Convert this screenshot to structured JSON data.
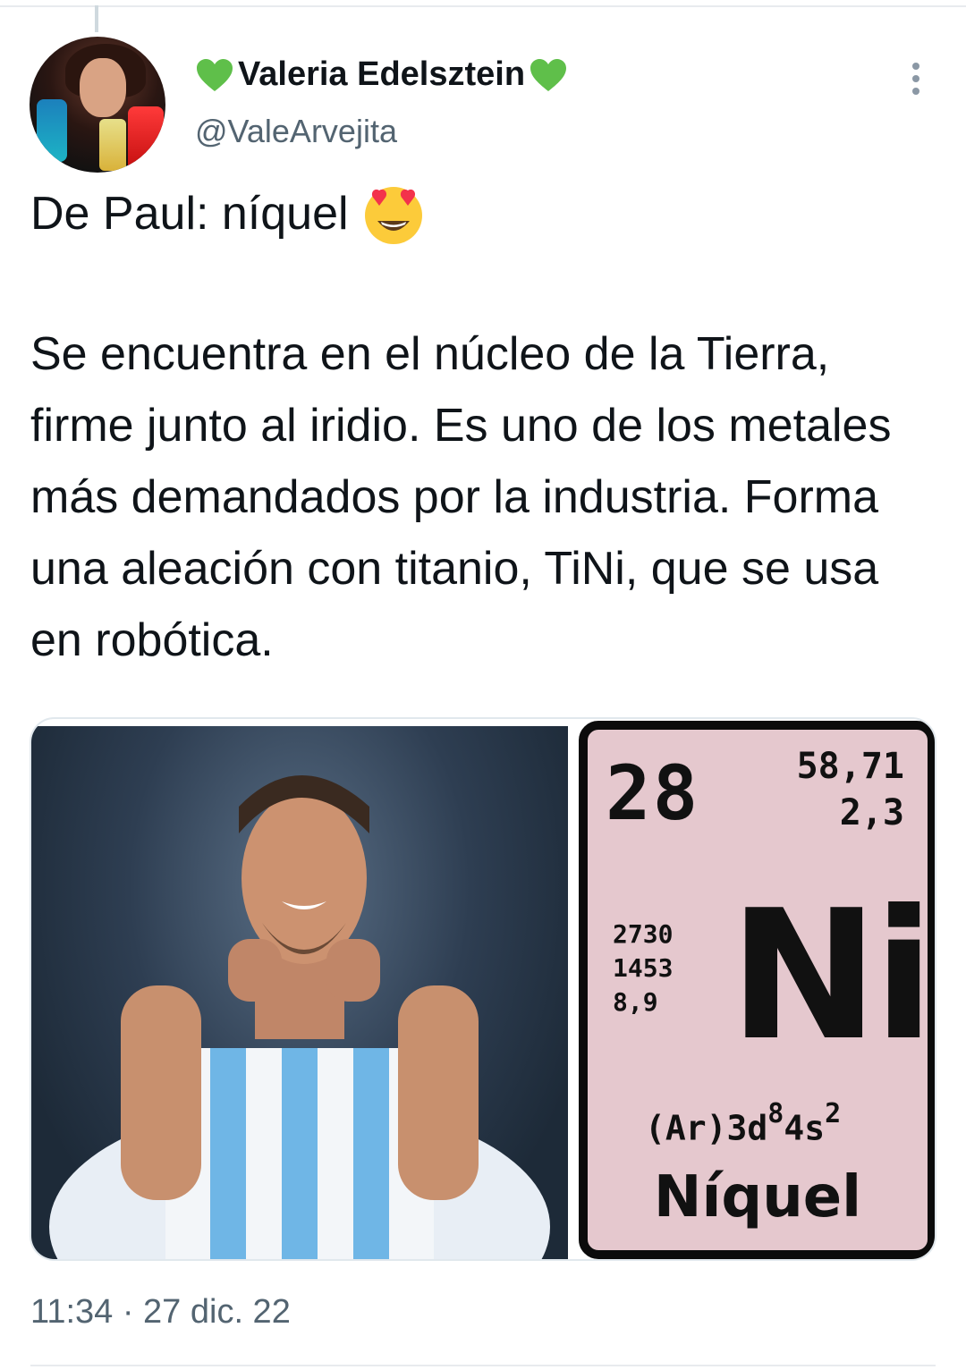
{
  "tweet": {
    "author": {
      "display_name": "Valeria Edelsztein",
      "handle": "@ValeArvejita",
      "name_decoration": "green-heart-icon"
    },
    "text_line1": "De Paul: níquel",
    "text_emoji": "smiling-face-with-heart-eyes-icon",
    "text_paragraph": "Se encuentra en el núcleo de la Tierra, firme junto al iridio. Es uno de los metales más demandados por la industria. Forma una aleación con titanio, TiNi, que se usa en robótica.",
    "timestamp": "11:34 · 27 dic. 22"
  },
  "media": {
    "photo": "football-player-photo",
    "element_card": {
      "atomic_number": "28",
      "atomic_mass": "58,71",
      "electronegativity": "2,3",
      "boiling_point": "2730",
      "melting_point": "1453",
      "density": "8,9",
      "symbol": "Ni",
      "config_base": "(Ar)3d",
      "config_sup1": "8",
      "config_mid": "4s",
      "config_sup2": "2",
      "name": "Níquel",
      "background_color": "#e5c8ce"
    }
  },
  "colors": {
    "text_primary": "#0f1419",
    "text_secondary": "#536471",
    "heart_green": "#5fbf4a"
  }
}
